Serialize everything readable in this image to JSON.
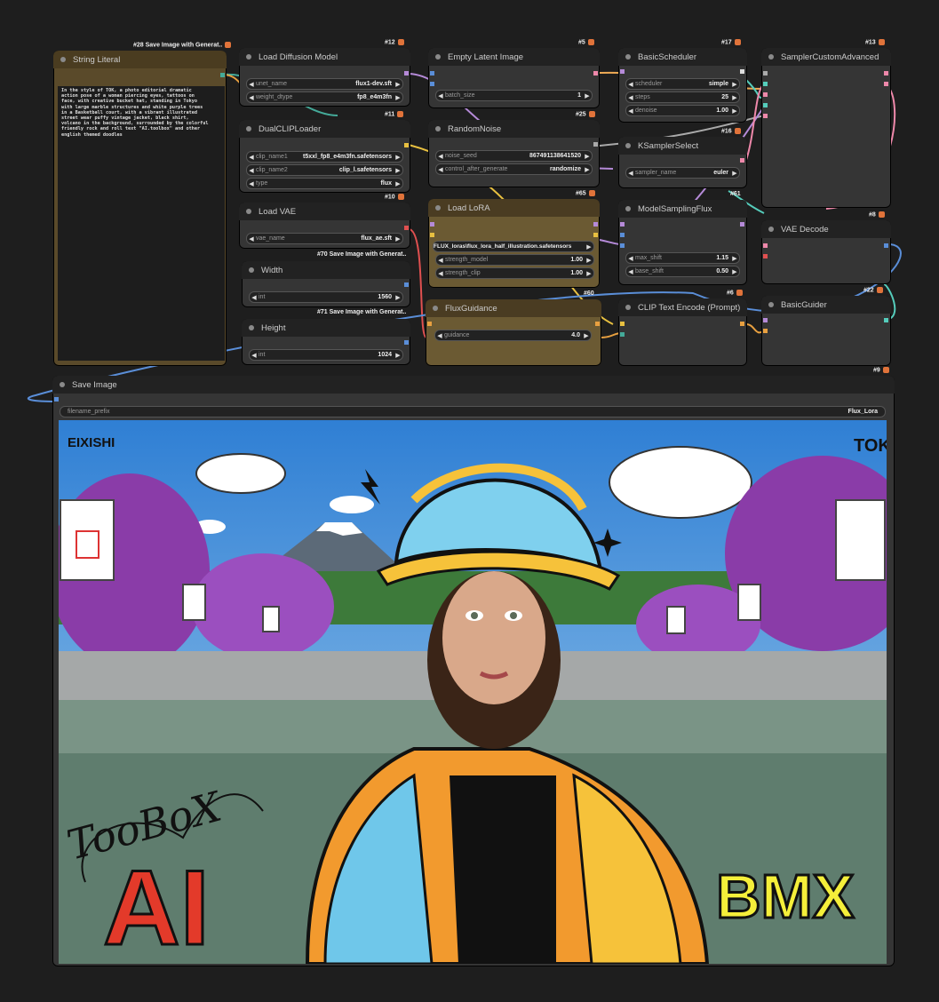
{
  "string_literal": {
    "title": "String Literal",
    "badge": "#28 Save Image with Generat..",
    "text": "In the style of TOK, a photo editorial dramatic\naction pose of a woman piercing eyes, tattoos on\nface, with creative bucket hat, standing in Tokyo\nwith large marble structures and white purple trees\nin a Basketball court, with a vibrant illustrated\nstreet wear puffy vintage jacket, black shirt,\nvolcano in the background, surrounded by the colorful\nfriendly rock and roll text \"AI.toolbox\" and other\nenglish themed doodles"
  },
  "load_diffusion": {
    "title": "Load Diffusion Model",
    "badge": "#12",
    "w1_label": "unet_name",
    "w1_val": "flux1-dev.sft",
    "w2_label": "weight_dtype",
    "w2_val": "fp8_e4m3fn"
  },
  "dualclip": {
    "title": "DualCLIPLoader",
    "badge": "#11",
    "w1_label": "clip_name1",
    "w1_val": "t5xxl_fp8_e4m3fn.safetensors",
    "w2_label": "clip_name2",
    "w2_val": "clip_l.safetensors",
    "w3_label": "type",
    "w3_val": "flux"
  },
  "load_vae": {
    "title": "Load VAE",
    "badge": "#10",
    "w1_label": "vae_name",
    "w1_val": "flux_ae.sft"
  },
  "width": {
    "title": "Width",
    "badge": "#70 Save Image with Generat..",
    "w1_label": "int",
    "w1_val": "1560"
  },
  "height": {
    "title": "Height",
    "badge": "#71 Save Image with Generat..",
    "w1_label": "int",
    "w1_val": "1024"
  },
  "empty_latent": {
    "title": "Empty Latent Image",
    "badge": "#5",
    "w1_label": "batch_size",
    "w1_val": "1"
  },
  "random_noise": {
    "title": "RandomNoise",
    "badge": "#25",
    "w1_label": "noise_seed",
    "w1_val": "867491138641520",
    "w2_label": "control_after_generate",
    "w2_val": "randomize"
  },
  "load_lora": {
    "title": "Load LoRA",
    "badge": "#65",
    "w1_val": "FLUX_loras\\flux_lora_half_illustration.safetensors",
    "w2_label": "strength_model",
    "w2_val": "1.00",
    "w3_label": "strength_clip",
    "w3_val": "1.00"
  },
  "flux_guidance": {
    "title": "FluxGuidance",
    "badge": "#60",
    "w1_label": "guidance",
    "w1_val": "4.0"
  },
  "basic_scheduler": {
    "title": "BasicScheduler",
    "badge": "#17",
    "w1_label": "scheduler",
    "w1_val": "simple",
    "w2_label": "steps",
    "w2_val": "25",
    "w3_label": "denoise",
    "w3_val": "1.00"
  },
  "ksampler_select": {
    "title": "KSamplerSelect",
    "badge": "#16",
    "w1_label": "sampler_name",
    "w1_val": "euler"
  },
  "model_sampling": {
    "title": "ModelSamplingFlux",
    "badge": "#61",
    "w1_label": "max_shift",
    "w1_val": "1.15",
    "w2_label": "base_shift",
    "w2_val": "0.50"
  },
  "clip_text": {
    "title": "CLIP Text Encode (Prompt)",
    "badge": "#6"
  },
  "sampler_custom": {
    "title": "SamplerCustomAdvanced",
    "badge": "#13"
  },
  "vae_decode": {
    "title": "VAE Decode",
    "badge": "#8"
  },
  "basic_guider": {
    "title": "BasicGuider",
    "badge": "#22"
  },
  "save_image": {
    "title": "Save Image",
    "badge": "#9",
    "w1_label": "filename_prefix",
    "w1_val": "Flux_Lora"
  },
  "image_text": {
    "logo": "EIXISHI",
    "corner": "TOK",
    "scribble": "TooBoX",
    "big_left": "AI",
    "big_right": "BMX"
  },
  "colors": {
    "bg": "#1e1e1e",
    "node": "#353535",
    "header": "#222222",
    "brown_node": "#5a4a2a",
    "lora_node": "#6b5a33"
  }
}
